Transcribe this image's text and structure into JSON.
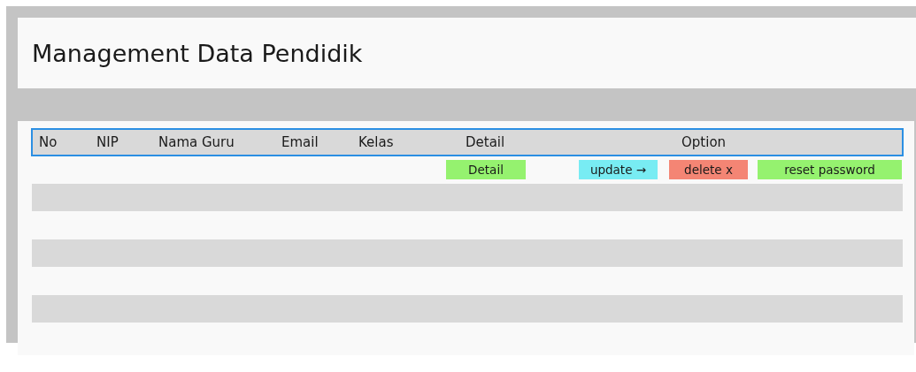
{
  "header": {
    "title": "Management Data Pendidik"
  },
  "table": {
    "columns": [
      "No",
      "NIP",
      "Nama Guru",
      "Email",
      "Kelas",
      "Detail",
      "Option"
    ],
    "actions": [
      {
        "label": "Detail",
        "color": "#95f26f"
      },
      {
        "label": "update →",
        "color": "#78ecf3"
      },
      {
        "label": "delete x",
        "color": "#f48574"
      },
      {
        "label": "reset password",
        "color": "#95f26f"
      }
    ]
  }
}
